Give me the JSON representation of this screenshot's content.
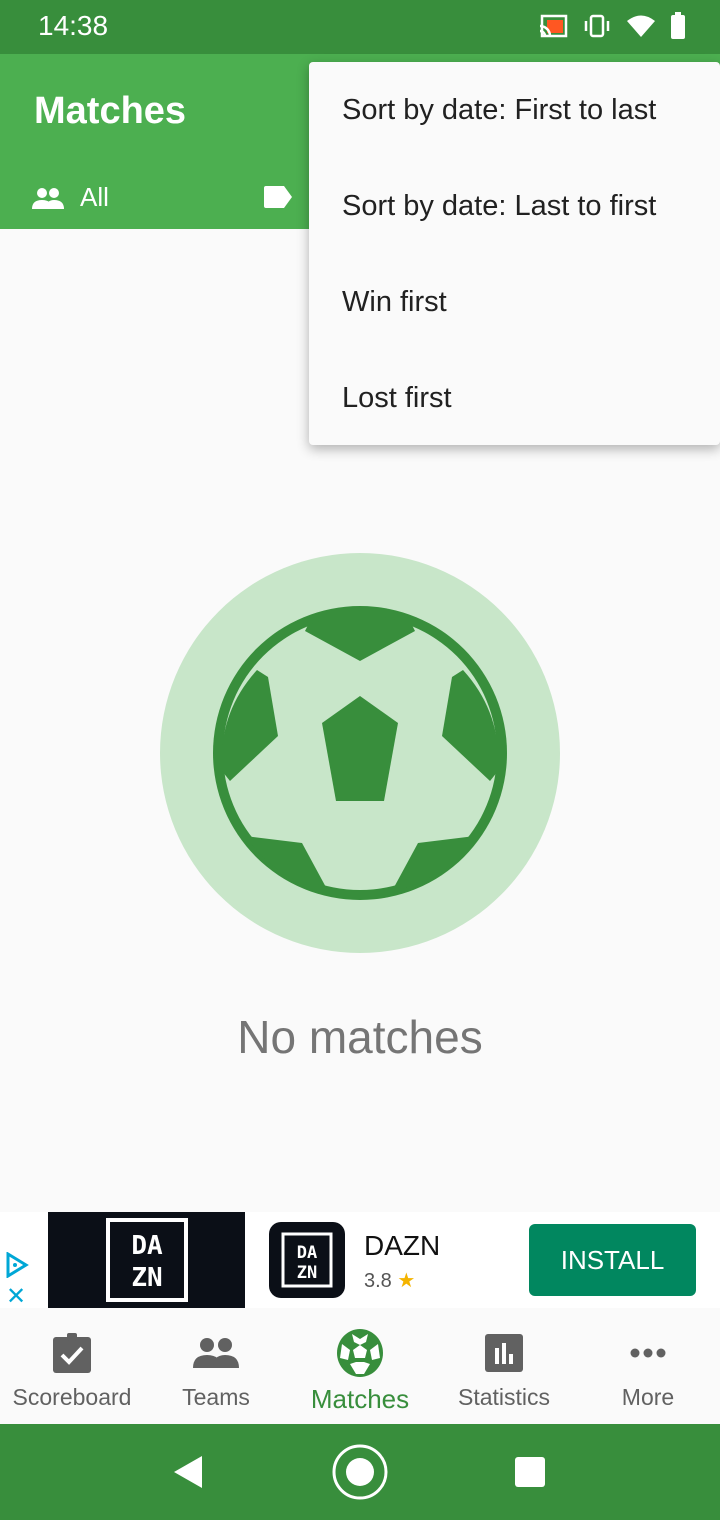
{
  "status_bar": {
    "time": "14:38",
    "icons": [
      "cast-icon",
      "vibrate-icon",
      "wifi-icon",
      "battery-icon"
    ]
  },
  "app_bar": {
    "title": "Matches",
    "filter_label": "All",
    "filter_icon": "people-icon",
    "tag_icon": "label-icon"
  },
  "sort_menu": {
    "items": [
      {
        "label": "Sort by date: First to last"
      },
      {
        "label": "Sort by date: Last to first"
      },
      {
        "label": "Win first"
      },
      {
        "label": "Lost first"
      }
    ]
  },
  "empty_state": {
    "icon": "soccer-ball-icon",
    "text": "No matches"
  },
  "ad": {
    "banner_text_top": "DA",
    "banner_text_bottom": "ZN",
    "app_name": "DAZN",
    "rating": "3.8",
    "star": "★",
    "install_label": "INSTALL",
    "close": "✕"
  },
  "bottom_nav": {
    "items": [
      {
        "label": "Scoreboard",
        "icon": "clipboard-check-icon",
        "active": false
      },
      {
        "label": "Teams",
        "icon": "people-icon",
        "active": false
      },
      {
        "label": "Matches",
        "icon": "soccer-ball-icon",
        "active": true
      },
      {
        "label": "Statistics",
        "icon": "bar-chart-icon",
        "active": false
      },
      {
        "label": "More",
        "icon": "more-horiz-icon",
        "active": false
      }
    ]
  },
  "colors": {
    "primary": "#4caf50",
    "primary_dark": "#388e3c",
    "accent_light": "#c8e6c9",
    "install_green": "#01875f"
  }
}
